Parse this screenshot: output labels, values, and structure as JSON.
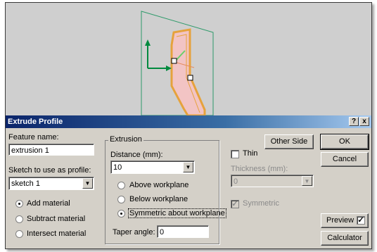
{
  "dialog": {
    "title": "Extrude Profile",
    "help_label": "?",
    "close_label": "x"
  },
  "feature_name": {
    "label": "Feature name:",
    "value": "extrusion 1"
  },
  "sketch": {
    "label": "Sketch to use as profile:",
    "value": "sketch 1",
    "dropdown_arrow": "▼"
  },
  "material": {
    "options": [
      "Add material",
      "Subtract material",
      "Intersect material"
    ],
    "selected": "Add material"
  },
  "extrusion": {
    "group_label": "Extrusion",
    "distance_label": "Distance (mm):",
    "distance_value": "10",
    "dropdown_arrow": "▼",
    "options": [
      "Above workplane",
      "Below workplane",
      "Symmetric about workplane"
    ],
    "selected": "Symmetric about workplane",
    "taper_label": "Taper angle:",
    "taper_value": "0"
  },
  "thin": {
    "other_side_label": "Other Side",
    "thin_label": "Thin",
    "thin_checked": false,
    "thickness_label": "Thickness (mm):",
    "thickness_value": "0",
    "dropdown_arrow": "▼",
    "symmetric_label": "Symmetric",
    "symmetric_checked": true
  },
  "buttons": {
    "ok": "OK",
    "cancel": "Cancel",
    "preview": "Preview",
    "preview_checked": true,
    "calculator": "Calculator",
    "check_mark": "✓"
  },
  "colors": {
    "title_bar": "#0a246a",
    "dialog_bg": "#d4d0c8",
    "viewport_bg": "#cfcfcf",
    "workplane": "#2e9a6a",
    "axis_arrow": "#008a3e",
    "profile_fill": "#f2c4c4",
    "profile_edge": "#e6a23c"
  }
}
